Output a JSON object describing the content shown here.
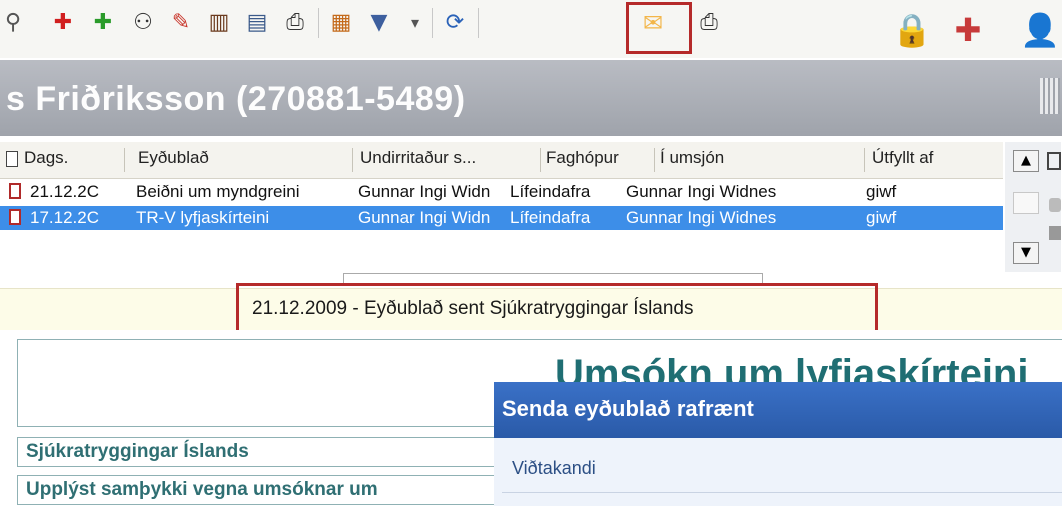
{
  "toolbar": {
    "icons": [
      "person-search-icon",
      "add-red-icon",
      "add-green-icon",
      "binoculars-icon",
      "eraser-icon",
      "books-icon",
      "report-icon",
      "print-document-icon",
      "filter-table-icon",
      "funnel-icon",
      "dropdown-arrow-icon",
      "refresh-icon",
      "envelope-icon",
      "printer-icon",
      "lock-icon",
      "medical-kit-icon",
      "user-icon"
    ],
    "glyphs": {
      "person-search": "⚲",
      "add": "✚",
      "binoculars": "⚇",
      "eraser": "✎",
      "books": "▥",
      "report": "▤",
      "print-doc": "⎙",
      "filter-table": "▦",
      "funnel": "▼",
      "dropdown": "▾",
      "refresh": "⟳",
      "envelope": "✉",
      "printer": "⎙",
      "lock": "🔒",
      "medkit": "✚",
      "user": "👤"
    },
    "colors": {
      "add_red": "#d11f1f",
      "add_green": "#2a9b2a",
      "envelope": "#f3b64a"
    }
  },
  "patient": {
    "name": "s Friðriksson (270881-5489)"
  },
  "grid": {
    "columns": [
      "Dags.",
      "Eyðublað",
      "Undirritaður s...",
      "Faghópur",
      "Í umsjón",
      "Útfyllt af"
    ],
    "rows": [
      {
        "date": "21.12.2C",
        "form": "Beiðni um myndgreini",
        "signed": "Gunnar Ingi Widn",
        "group": "Lífeindafra",
        "care": "Gunnar Ingi Widnes",
        "filled": "giwf"
      },
      {
        "date": "17.12.2C",
        "form": "TR-V lyfjaskírteini",
        "signed": "Gunnar Ingi Widn",
        "group": "Lífeindafra",
        "care": "Gunnar Ingi Widnes",
        "filled": "giwf"
      }
    ],
    "selected_color": "#3d8ee8"
  },
  "info": {
    "message": "21.12.2009 - Eyðublað sent Sjúkratryggingar Íslands"
  },
  "form": {
    "title": "Umsókn um lyfjaskírteini",
    "sections": [
      "Sjúkratryggingar Íslands",
      "Upplýst samþykki vegna umsóknar um"
    ]
  },
  "dialog": {
    "title": "Senda eyðublað rafrænt",
    "recipient_label": "Viðtakandi"
  },
  "highlight_color": "#b52a2a"
}
